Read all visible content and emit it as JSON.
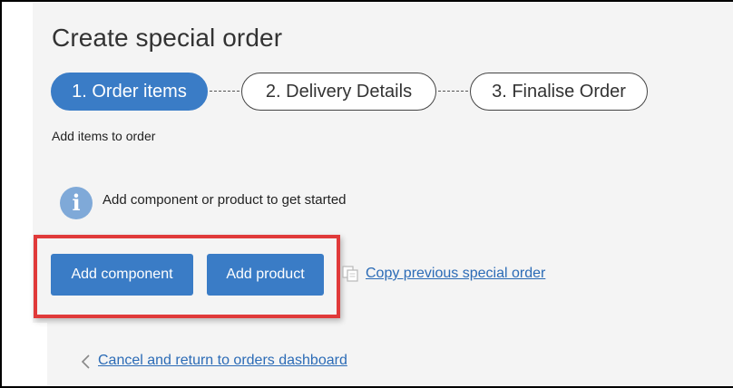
{
  "page": {
    "title": "Create special order",
    "subtitle": "Add items to order"
  },
  "steps": [
    {
      "label": "1. Order items",
      "active": true
    },
    {
      "label": "2. Delivery Details",
      "active": false
    },
    {
      "label": "3. Finalise Order",
      "active": false
    }
  ],
  "info": {
    "icon": "info-icon",
    "text": "Add component or product to get started"
  },
  "actions": {
    "add_component_label": "Add component",
    "add_product_label": "Add product",
    "copy_icon": "copy-icon",
    "copy_previous_label": "Copy previous special order"
  },
  "footer": {
    "back_icon": "chevron-left-icon",
    "cancel_label": "Cancel and return to orders dashboard"
  },
  "colors": {
    "primary": "#3a7cc6",
    "highlight": "#e03a3a",
    "link": "#2b6bb6",
    "info_icon": "#7fa9d8",
    "panel_bg": "#f4f4f4"
  }
}
